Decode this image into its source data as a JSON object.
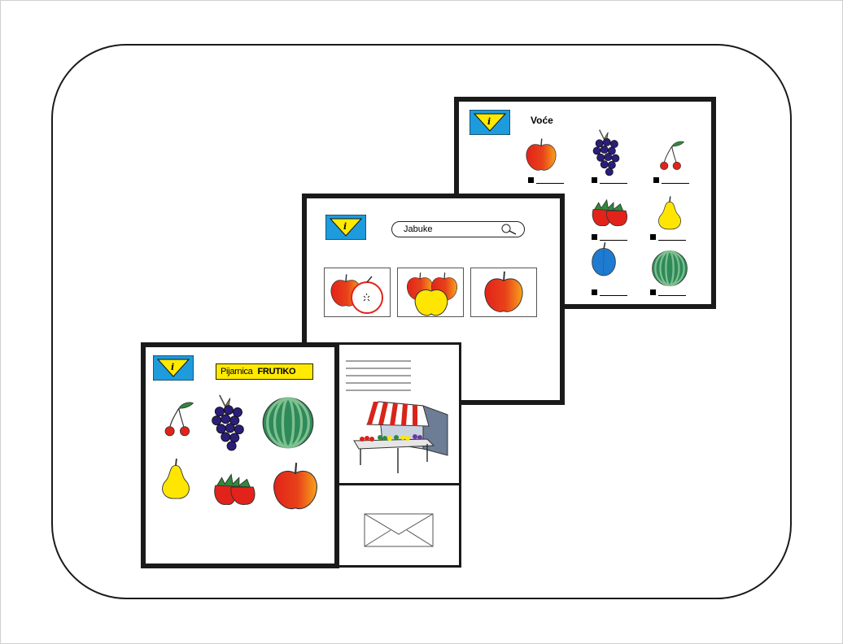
{
  "screens": {
    "catalog": {
      "title": "Voće",
      "fruits": [
        "apple-icon",
        "grapes-icon",
        "cherry-icon",
        "strawberry-icon",
        "pear-icon",
        "plum-icon",
        "watermelon-icon"
      ]
    },
    "search": {
      "query": "Jabuke",
      "results": [
        "apple-half-icon",
        "apple-trio-icon",
        "apple-icon"
      ]
    },
    "home": {
      "banner_regular": "Pijarnica",
      "banner_bold": "FRUTIKO",
      "fruits": [
        "cherry-icon",
        "grapes-icon",
        "watermelon-icon",
        "pear-icon",
        "strawberry-icon",
        "apple-icon"
      ]
    },
    "info": {
      "image": "market-stall-icon",
      "contact": "envelope-icon"
    }
  },
  "colors": {
    "logo_blue": "#1e9bdc",
    "logo_yellow": "#ffea00",
    "apple_red": "#e2231a",
    "grape_purple": "#2a1e7a",
    "melon_green": "#2f8a5a",
    "banner_yellow": "#ffea00"
  }
}
